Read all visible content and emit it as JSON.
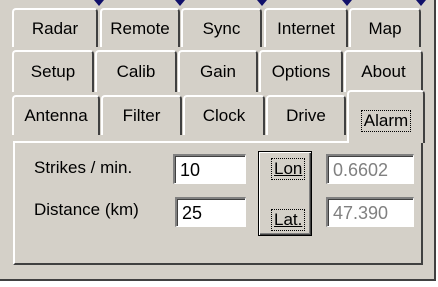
{
  "tabs_row1": [
    "Radar",
    "Remote",
    "Sync",
    "Internet",
    "Map"
  ],
  "tabs_row2": [
    "Setup",
    "Calib",
    "Gain",
    "Options",
    "About"
  ],
  "tabs_row3": [
    "Antenna",
    "Filter",
    "Clock",
    "Drive",
    "Alarm"
  ],
  "active_tab": "Alarm",
  "alarm": {
    "strikes_label": "Strikes / min.",
    "strikes_value": "10",
    "distance_label": "Distance (km)",
    "distance_value": "25",
    "lon_button_label": "Lon",
    "lat_button_label": "Lat.",
    "lon_value": "0.6602",
    "lat_value": "47.390"
  }
}
